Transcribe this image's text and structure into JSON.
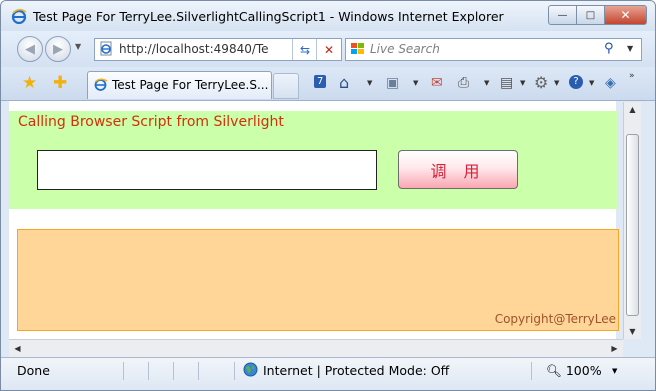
{
  "window": {
    "title": "Test Page For TerryLee.SilverlightCallingScript1 - Windows Internet Explorer",
    "minimize_glyph": "—",
    "maximize_glyph": "□",
    "close_glyph": "✕"
  },
  "nav": {
    "back_glyph": "◀",
    "forward_glyph": "▶",
    "address_url": "http://localhost:49840/Te",
    "refresh_glyph": "⇆",
    "stop_glyph": "✕",
    "search_placeholder": "Live Search"
  },
  "tabs": {
    "active_tab_label": "Test Page For TerryLee.S..."
  },
  "page": {
    "heading": "Calling Browser Script from Silverlight",
    "input_value": "",
    "call_button_label": "调 用",
    "copyright": "Copyright@TerryLee",
    "colors": {
      "green_panel": "#ccffaa",
      "orange_panel": "#ffd697",
      "heading": "#d4300a",
      "button_text": "#d4233b"
    }
  },
  "status": {
    "text": "Done",
    "zone": "Internet | Protected Mode: Off",
    "zoom": "100%"
  },
  "icons": [
    "ie-logo-icon",
    "page-icon",
    "refresh-icon",
    "stop-icon",
    "live-search-logo-icon",
    "search-icon",
    "favorites-star-icon",
    "add-favorites-icon",
    "new-tab-icon",
    "tabs-overview-icon",
    "home-icon",
    "rss-feeds-icon",
    "read-mail-icon",
    "print-icon",
    "page-menu-icon",
    "tools-gear-icon",
    "help-icon",
    "research-icon",
    "globe-icon",
    "zoom-icon"
  ]
}
